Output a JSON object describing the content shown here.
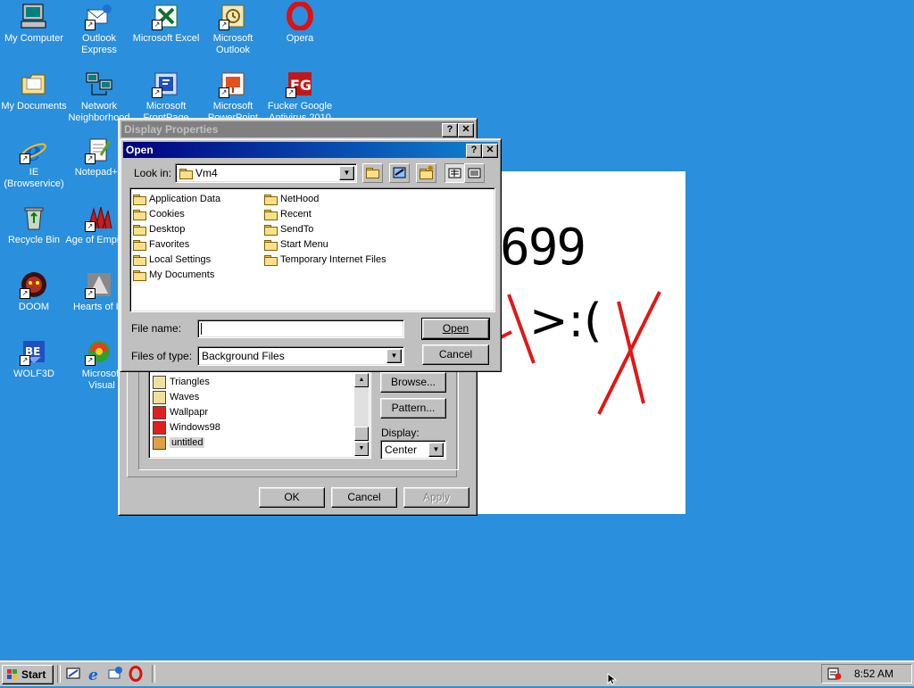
{
  "desktop": {
    "icons": [
      {
        "label": "My Computer"
      },
      {
        "label": "Outlook Express"
      },
      {
        "label": "Microsoft Excel"
      },
      {
        "label": "Microsoft Outlook"
      },
      {
        "label": "Opera"
      },
      {
        "label": "My Documents"
      },
      {
        "label": "Network Neighborhood"
      },
      {
        "label": "Microsoft FrontPage"
      },
      {
        "label": "Microsoft PowerPoint"
      },
      {
        "label": "Fucker Google Antivirus 2010"
      },
      {
        "label": "IE (Browservice)"
      },
      {
        "label": "Notepad++"
      },
      {
        "label": "Recycle Bin"
      },
      {
        "label": "Age of Empires"
      },
      {
        "label": "DOOM"
      },
      {
        "label": "Hearts of Iron"
      },
      {
        "label": "WOLF3D"
      },
      {
        "label": "Microsoft Visual InterDev"
      }
    ]
  },
  "wallpaper": {
    "number_text": "699",
    "face_text": ">:(",
    "marks_color": "#e01818"
  },
  "display_properties": {
    "title": "Display Properties",
    "help_btn": "?",
    "close_btn": "✕",
    "wallpaper_list": [
      {
        "name": "Triangles"
      },
      {
        "name": "Waves"
      },
      {
        "name": "Wallpapr"
      },
      {
        "name": "Windows98"
      },
      {
        "name": "untitled",
        "selected": true
      }
    ],
    "browse_label": "Browse...",
    "pattern_label": "Pattern...",
    "display_label": "Display:",
    "display_value": "Center",
    "ok_label": "OK",
    "cancel_label": "Cancel",
    "apply_label": "Apply"
  },
  "open_dialog": {
    "title": "Open",
    "help_btn": "?",
    "close_btn": "✕",
    "look_in_label": "Look in:",
    "look_in_value": "Vm4",
    "files_col1": [
      "Application Data",
      "Cookies",
      "Desktop",
      "Favorites",
      "Local Settings",
      "My Documents"
    ],
    "files_col2": [
      "NetHood",
      "Recent",
      "SendTo",
      "Start Menu",
      "Temporary Internet Files"
    ],
    "file_name_label": "File name:",
    "file_name_value": "",
    "files_of_type_label": "Files of type:",
    "files_of_type_value": "Background Files",
    "open_label": "Open",
    "cancel_label": "Cancel"
  },
  "taskbar": {
    "start_label": "Start",
    "clock": "8:52 AM"
  }
}
